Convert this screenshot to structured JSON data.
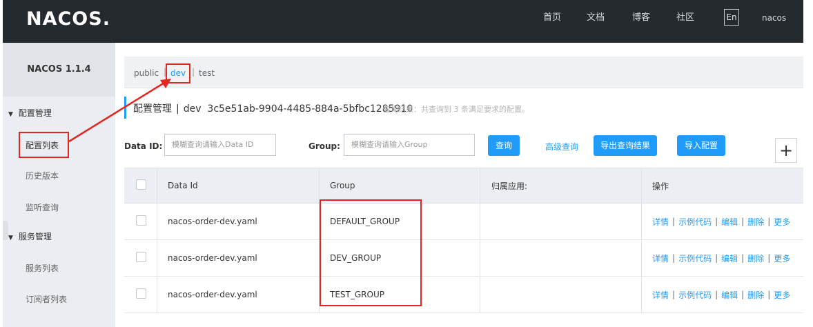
{
  "header": {
    "logo": "NACOS.",
    "nav": [
      "首页",
      "文档",
      "博客",
      "社区"
    ],
    "lang": "En",
    "user": "nacos"
  },
  "sidebar": {
    "version": "NACOS 1.1.4",
    "groups": [
      {
        "title": "配置管理",
        "items": [
          "配置列表",
          "历史版本",
          "监听查询"
        ]
      },
      {
        "title": "服务管理",
        "items": [
          "服务列表",
          "订阅者列表"
        ]
      }
    ]
  },
  "namespaces": [
    "public",
    "dev",
    "test"
  ],
  "namespace_sep": "|",
  "title": {
    "main": "配置管理",
    "sep": "|",
    "namespace": "dev",
    "namespace_id": "3c5e51ab-9904-4485-884a-5bfbc1285910",
    "result": "查询结果：共查询到 3 条满足要求的配置。"
  },
  "search": {
    "dataid_label": "Data ID:",
    "dataid_placeholder": "模糊查询请输入Data ID",
    "group_label": "Group:",
    "group_placeholder": "模糊查询请输入Group",
    "query_button": "查询",
    "advanced_link": "高级查询",
    "export_button": "导出查询结果",
    "import_button": "导入配置",
    "add_button": "+"
  },
  "table": {
    "headers": [
      "Data Id",
      "Group",
      "归属应用:",
      "操作"
    ],
    "rows": [
      {
        "dataid": "nacos-order-dev.yaml",
        "group": "DEFAULT_GROUP",
        "app": ""
      },
      {
        "dataid": "nacos-order-dev.yaml",
        "group": "DEV_GROUP",
        "app": ""
      },
      {
        "dataid": "nacos-order-dev.yaml",
        "group": "TEST_GROUP",
        "app": ""
      }
    ],
    "operations": [
      "详情",
      "示例代码",
      "编辑",
      "删除",
      "更多"
    ],
    "op_sep": "|"
  },
  "colors": {
    "topbar": "#252a2f",
    "accent": "#209bfa",
    "annotation": "#e5251f"
  }
}
